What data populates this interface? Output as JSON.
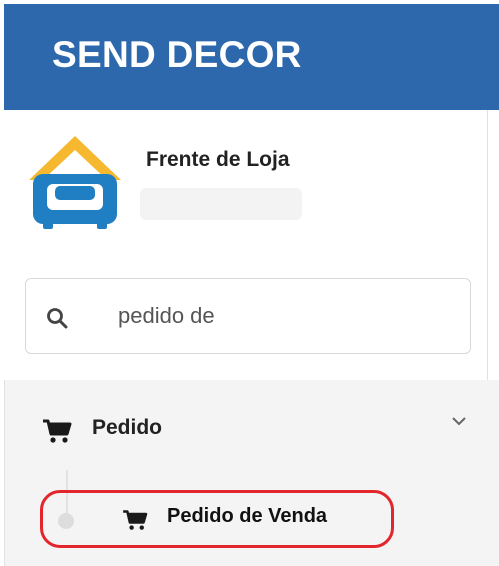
{
  "app": {
    "brand": "SEND DECOR"
  },
  "user_panel": {
    "name": "Frente de Loja",
    "logo_icon": "armchair-house-logo",
    "colors": {
      "roof": "#f5b82e",
      "chair": "#1f7fc2"
    }
  },
  "search": {
    "value": "pedido de",
    "icon": "search-icon"
  },
  "menu": {
    "items": [
      {
        "label": "Pedido",
        "icon": "cart-icon",
        "expanded": true,
        "children": [
          {
            "label": "Pedido de Venda",
            "icon": "cart-icon",
            "highlighted": true
          }
        ]
      }
    ]
  },
  "colors": {
    "header": "#2d68ad",
    "highlight": "#e3262b"
  }
}
